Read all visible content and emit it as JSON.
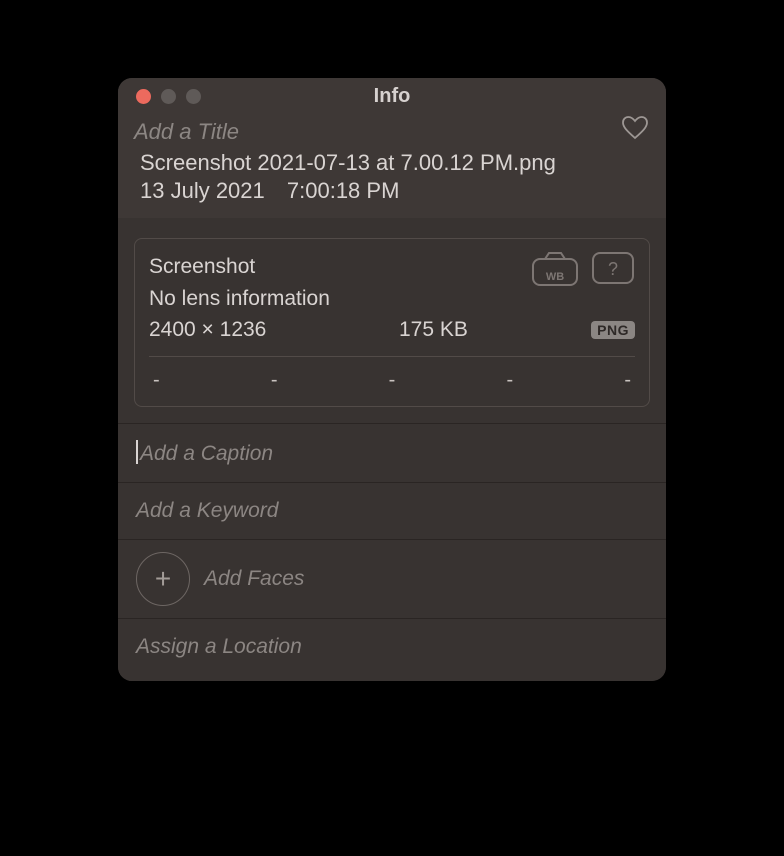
{
  "window": {
    "title": "Info"
  },
  "traffic": {
    "close": "#ec6a5e",
    "min": "#5f5a58",
    "max": "#5f5a58"
  },
  "header": {
    "title_placeholder": "Add a Title",
    "filename": "Screenshot 2021-07-13 at 7.00.12 PM.png",
    "date": "13 July 2021",
    "time": "7:00:18 PM"
  },
  "camera": {
    "source": "Screenshot",
    "lens": "No lens information",
    "dimensions": "2400 × 1236",
    "filesize": "175 KB",
    "format": "PNG",
    "exif_slots": [
      "-",
      "-",
      "-",
      "-",
      "-"
    ]
  },
  "sections": {
    "caption_placeholder": "Add a Caption",
    "keyword_placeholder": "Add a Keyword",
    "faces_label": "Add Faces",
    "location_placeholder": "Assign a Location"
  }
}
